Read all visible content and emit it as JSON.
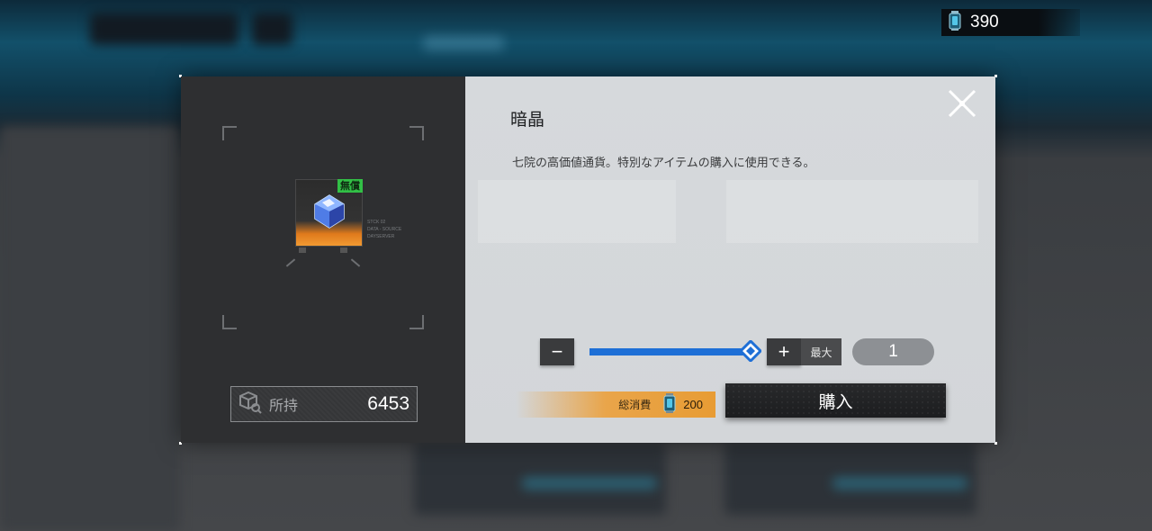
{
  "currency": {
    "icon": "crystal-vial-icon",
    "amount": "390"
  },
  "item": {
    "name": "暗晶",
    "description": "七院の高価値通貨。特別なアイテムの購入に使用できる。",
    "badge": "無償",
    "icon": "dark-crystal-icon",
    "meta_lines": [
      "STCK 02",
      "DATA - SOURCE",
      "DAYSERVER"
    ]
  },
  "owned": {
    "label": "所持",
    "value": "6453",
    "icon": "inventory-box-icon"
  },
  "quantity": {
    "minus_label": "−",
    "plus_label": "+",
    "max_label": "最大",
    "value": "1",
    "slider_fraction": 1.0
  },
  "total": {
    "label": "総消費",
    "icon": "crystal-vial-icon",
    "value": "200"
  },
  "buy_label": "購入",
  "colors": {
    "accent_blue": "#1e6fd6",
    "accent_orange": "#e89c34",
    "free_green": "#32c046"
  }
}
